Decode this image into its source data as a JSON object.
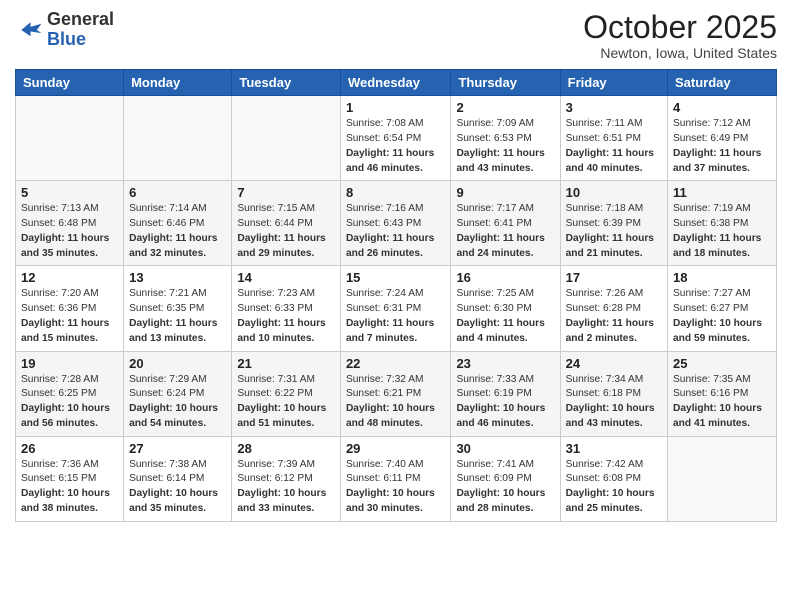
{
  "header": {
    "logo_general": "General",
    "logo_blue": "Blue",
    "month": "October 2025",
    "location": "Newton, Iowa, United States"
  },
  "weekdays": [
    "Sunday",
    "Monday",
    "Tuesday",
    "Wednesday",
    "Thursday",
    "Friday",
    "Saturday"
  ],
  "weeks": [
    [
      {
        "day": "",
        "content": ""
      },
      {
        "day": "",
        "content": ""
      },
      {
        "day": "",
        "content": ""
      },
      {
        "day": "1",
        "content": "Sunrise: 7:08 AM\nSunset: 6:54 PM\nDaylight: 11 hours and 46 minutes."
      },
      {
        "day": "2",
        "content": "Sunrise: 7:09 AM\nSunset: 6:53 PM\nDaylight: 11 hours and 43 minutes."
      },
      {
        "day": "3",
        "content": "Sunrise: 7:11 AM\nSunset: 6:51 PM\nDaylight: 11 hours and 40 minutes."
      },
      {
        "day": "4",
        "content": "Sunrise: 7:12 AM\nSunset: 6:49 PM\nDaylight: 11 hours and 37 minutes."
      }
    ],
    [
      {
        "day": "5",
        "content": "Sunrise: 7:13 AM\nSunset: 6:48 PM\nDaylight: 11 hours and 35 minutes."
      },
      {
        "day": "6",
        "content": "Sunrise: 7:14 AM\nSunset: 6:46 PM\nDaylight: 11 hours and 32 minutes."
      },
      {
        "day": "7",
        "content": "Sunrise: 7:15 AM\nSunset: 6:44 PM\nDaylight: 11 hours and 29 minutes."
      },
      {
        "day": "8",
        "content": "Sunrise: 7:16 AM\nSunset: 6:43 PM\nDaylight: 11 hours and 26 minutes."
      },
      {
        "day": "9",
        "content": "Sunrise: 7:17 AM\nSunset: 6:41 PM\nDaylight: 11 hours and 24 minutes."
      },
      {
        "day": "10",
        "content": "Sunrise: 7:18 AM\nSunset: 6:39 PM\nDaylight: 11 hours and 21 minutes."
      },
      {
        "day": "11",
        "content": "Sunrise: 7:19 AM\nSunset: 6:38 PM\nDaylight: 11 hours and 18 minutes."
      }
    ],
    [
      {
        "day": "12",
        "content": "Sunrise: 7:20 AM\nSunset: 6:36 PM\nDaylight: 11 hours and 15 minutes."
      },
      {
        "day": "13",
        "content": "Sunrise: 7:21 AM\nSunset: 6:35 PM\nDaylight: 11 hours and 13 minutes."
      },
      {
        "day": "14",
        "content": "Sunrise: 7:23 AM\nSunset: 6:33 PM\nDaylight: 11 hours and 10 minutes."
      },
      {
        "day": "15",
        "content": "Sunrise: 7:24 AM\nSunset: 6:31 PM\nDaylight: 11 hours and 7 minutes."
      },
      {
        "day": "16",
        "content": "Sunrise: 7:25 AM\nSunset: 6:30 PM\nDaylight: 11 hours and 4 minutes."
      },
      {
        "day": "17",
        "content": "Sunrise: 7:26 AM\nSunset: 6:28 PM\nDaylight: 11 hours and 2 minutes."
      },
      {
        "day": "18",
        "content": "Sunrise: 7:27 AM\nSunset: 6:27 PM\nDaylight: 10 hours and 59 minutes."
      }
    ],
    [
      {
        "day": "19",
        "content": "Sunrise: 7:28 AM\nSunset: 6:25 PM\nDaylight: 10 hours and 56 minutes."
      },
      {
        "day": "20",
        "content": "Sunrise: 7:29 AM\nSunset: 6:24 PM\nDaylight: 10 hours and 54 minutes."
      },
      {
        "day": "21",
        "content": "Sunrise: 7:31 AM\nSunset: 6:22 PM\nDaylight: 10 hours and 51 minutes."
      },
      {
        "day": "22",
        "content": "Sunrise: 7:32 AM\nSunset: 6:21 PM\nDaylight: 10 hours and 48 minutes."
      },
      {
        "day": "23",
        "content": "Sunrise: 7:33 AM\nSunset: 6:19 PM\nDaylight: 10 hours and 46 minutes."
      },
      {
        "day": "24",
        "content": "Sunrise: 7:34 AM\nSunset: 6:18 PM\nDaylight: 10 hours and 43 minutes."
      },
      {
        "day": "25",
        "content": "Sunrise: 7:35 AM\nSunset: 6:16 PM\nDaylight: 10 hours and 41 minutes."
      }
    ],
    [
      {
        "day": "26",
        "content": "Sunrise: 7:36 AM\nSunset: 6:15 PM\nDaylight: 10 hours and 38 minutes."
      },
      {
        "day": "27",
        "content": "Sunrise: 7:38 AM\nSunset: 6:14 PM\nDaylight: 10 hours and 35 minutes."
      },
      {
        "day": "28",
        "content": "Sunrise: 7:39 AM\nSunset: 6:12 PM\nDaylight: 10 hours and 33 minutes."
      },
      {
        "day": "29",
        "content": "Sunrise: 7:40 AM\nSunset: 6:11 PM\nDaylight: 10 hours and 30 minutes."
      },
      {
        "day": "30",
        "content": "Sunrise: 7:41 AM\nSunset: 6:09 PM\nDaylight: 10 hours and 28 minutes."
      },
      {
        "day": "31",
        "content": "Sunrise: 7:42 AM\nSunset: 6:08 PM\nDaylight: 10 hours and 25 minutes."
      },
      {
        "day": "",
        "content": ""
      }
    ]
  ]
}
